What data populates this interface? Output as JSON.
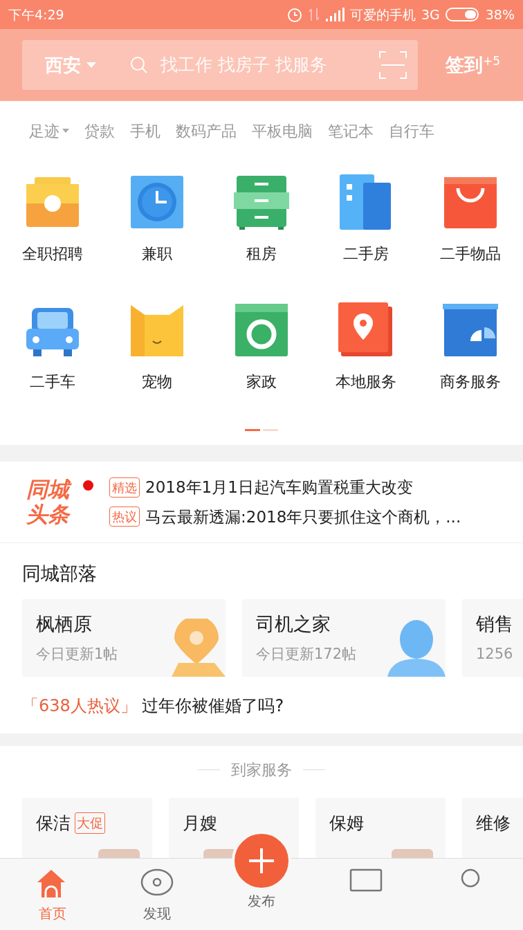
{
  "status_bar": {
    "time": "下午4:29",
    "carrier": "可爱的手机",
    "network": "3G",
    "battery": "38%"
  },
  "header": {
    "city": "西安",
    "search": {
      "placeholder": "找工作 找房子 找服务"
    },
    "checkin": "签到$^{+5}$"
  },
  "quick_tags": [
    {
      "label": "足迹",
      "dropdown": true
    },
    {
      "label": "贷款",
      "dropdown": false
    },
    {
      "label": "手机",
      "dropdown": false
    },
    {
      "label": "数码产品",
      "dropdown": false
    },
    {
      "label": "平板电脑",
      "dropdown": false
    },
    {
      "label": "笔记本",
      "dropdown": false
    },
    {
      "label": "自行车",
      "dropdown": false
    }
  ],
  "categories": [
    {
      "label": "全职招聘",
      "kind": "briefcase"
    },
    {
      "label": "兼职",
      "kind": "clock"
    },
    {
      "label": "租房",
      "kind": "cabinet"
    },
    {
      "label": "二手房",
      "kind": "building"
    },
    {
      "label": "二手物品",
      "kind": "bag"
    },
    {
      "label": "二手车",
      "kind": "car"
    },
    {
      "label": "宠物",
      "kind": "cat"
    },
    {
      "label": "家政",
      "kind": "washer"
    },
    {
      "label": "本地服务",
      "kind": "pin"
    },
    {
      "label": "商务服务",
      "kind": "chart"
    }
  ],
  "pager": [
    {
      "selected": true
    },
    {
      "selected": false
    }
  ],
  "headlines": {
    "logo_top": "同城",
    "logo_bottom": "头条",
    "items": [
      {
        "tag": "精选",
        "text": "2018年1月1日起汽车购置税重大改变"
      },
      {
        "tag": "热议",
        "text": "马云最新透漏:2018年只要抓住这个商机，..."
      }
    ]
  },
  "tribe": {
    "title": "同城部落",
    "cards": [
      {
        "name": "枫栖原",
        "info": "今日更新1帖",
        "kind": "pin"
      },
      {
        "name": "司机之家",
        "info": "今日更新172帖",
        "kind": "person"
      },
      {
        "name": "销售",
        "info": "1256",
        "kind": "none"
      }
    ],
    "topic": {
      "count": "「638人热议」",
      "text": "过年你被催婚了吗?"
    }
  },
  "home_services": {
    "title": "到家服务",
    "cards": [
      {
        "name": "保洁",
        "badge": "大促",
        "photo": true
      },
      {
        "name": "月嫂",
        "photo": true
      },
      {
        "name": "保姆",
        "photo": true
      },
      {
        "name": "维修",
        "photo": false
      }
    ]
  },
  "tabbar": [
    {
      "label": "首页",
      "kind": "home",
      "selected": true
    },
    {
      "label": "发现",
      "kind": "eye",
      "selected": false
    },
    {
      "label": "发布",
      "kind": "plus",
      "selected": false
    },
    {
      "kind": "message",
      "selected": false
    },
    {
      "kind": "user",
      "selected": false
    }
  ]
}
